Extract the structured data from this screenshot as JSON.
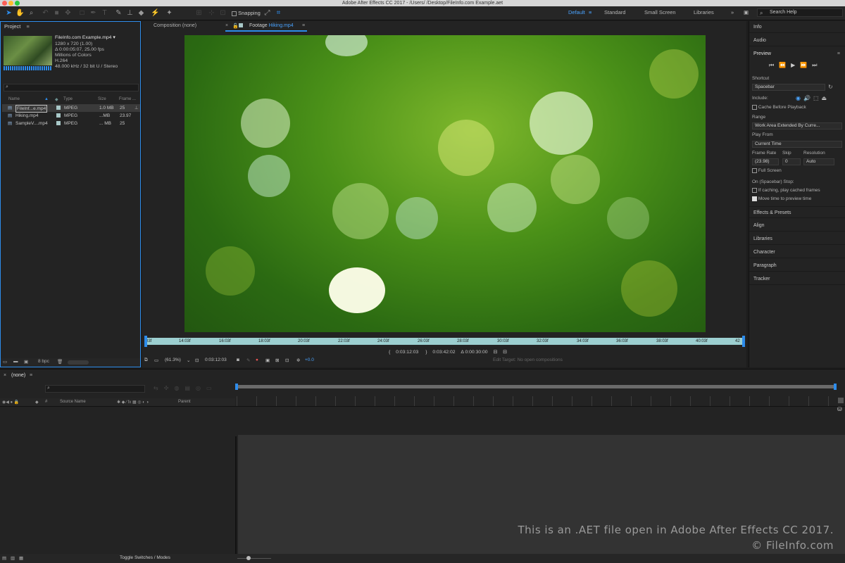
{
  "window": {
    "title": "Adobe After Effects CC 2017 - /Users/                 /Desktop/FileInfo.com Example.aet"
  },
  "toolbar": {
    "snapping_label": "Snapping",
    "search_placeholder": "Search Help"
  },
  "workspaces": [
    "Default",
    "Standard",
    "Small Screen",
    "Libraries"
  ],
  "workspace_active": "Default",
  "project": {
    "panel_title": "Project",
    "selected_name": "FileInfo.com Example.mp4 ▾",
    "info": [
      "1280 x 720 (1.00)",
      "Δ 0:00:05:07, 25.00 fps",
      "Millions of Colors",
      "H.264",
      "48.000 kHz / 32 bit U / Stereo"
    ],
    "columns": [
      "Name",
      "Type",
      "Size",
      "Frame ..."
    ],
    "rows": [
      {
        "name": "FileInf...e.mp4",
        "type": "MPEG",
        "size": "1.0 MB",
        "fps": "25"
      },
      {
        "name": "Hiking.mp4",
        "type": "MPEG",
        "size": "...MB",
        "fps": "23.97"
      },
      {
        "name": "SampleV....mp4",
        "type": "MPEG",
        "size": "... MB",
        "fps": "25"
      }
    ],
    "bpc_label": "8 bpc"
  },
  "viewer": {
    "tab_comp": "Composition (none)",
    "tab_footage_prefix": "Footage",
    "tab_footage_name": "Hiking.mp4",
    "ruler_ticks": [
      "03f",
      "14:03f",
      "16:03f",
      "18:03f",
      "20:03f",
      "22:03f",
      "24:03f",
      "26:03f",
      "28:03f",
      "30:03f",
      "32:03f",
      "34:03f",
      "36:03f",
      "38:03f",
      "40:03f",
      "42"
    ],
    "in_time": "0:03:12:03",
    "out_time": "0:03:42:02",
    "duration": "Δ 0:00:30:00",
    "zoom": "(61.3%)",
    "current_time": "0:03:12:03",
    "exposure": "+0.0",
    "edit_target": "Edit Target: No open compositions"
  },
  "right_panel": {
    "sections_top": [
      "Info",
      "Audio"
    ],
    "preview_title": "Preview",
    "shortcut_label": "Shortcut",
    "shortcut_value": "Spacebar",
    "include_label": "Include:",
    "cache_before_playback": "Cache Before Playback",
    "range_label": "Range",
    "range_value": "Work Area Extended By Curre...",
    "play_from_label": "Play From",
    "play_from_value": "Current Time",
    "frame_rate_label": "Frame Rate",
    "skip_label": "Skip",
    "resolution_label": "Resolution",
    "frame_rate_value": "(23.98)",
    "skip_value": "0",
    "resolution_value": "Auto",
    "full_screen": "Full Screen",
    "on_stop_label": "On (Spacebar) Stop:",
    "if_caching": "If caching, play cached frames",
    "move_time": "Move time to preview time",
    "sections_bottom": [
      "Effects & Presets",
      "Align",
      "Libraries",
      "Character",
      "Paragraph",
      "Tracker"
    ]
  },
  "timeline": {
    "tab": "(none)",
    "col_source": "Source Name",
    "col_parent": "Parent",
    "col_hash": "#",
    "toggle_label": "Toggle Switches / Modes"
  },
  "watermark": {
    "line1": "This is an .AET file open in Adobe After Effects CC 2017.",
    "line2": "© FileInfo.com"
  }
}
